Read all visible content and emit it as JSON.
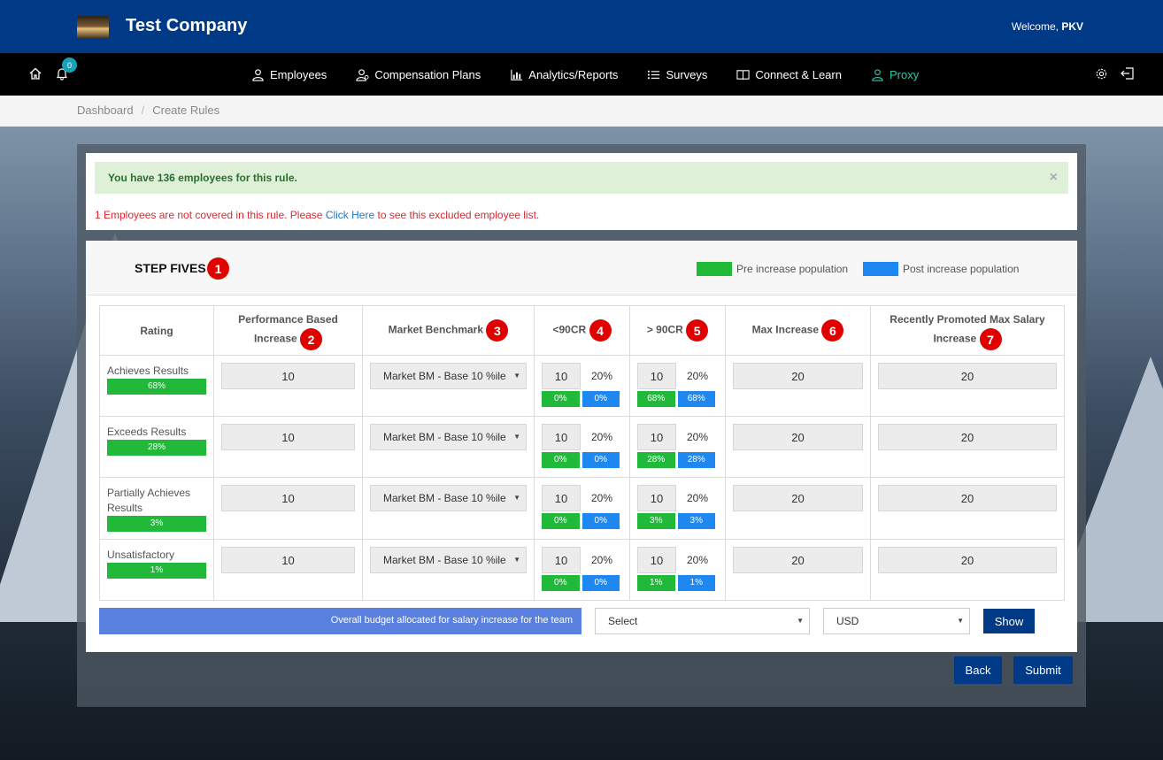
{
  "header": {
    "company": "Test Company",
    "welcome_prefix": "Welcome, ",
    "user": "PKV"
  },
  "nav": {
    "notification_count": "0",
    "items": [
      {
        "label": "Employees",
        "icon": "user-icon"
      },
      {
        "label": "Compensation Plans",
        "icon": "user-gear-icon"
      },
      {
        "label": "Analytics/Reports",
        "icon": "bar-chart-icon"
      },
      {
        "label": "Surveys",
        "icon": "list-icon"
      },
      {
        "label": "Connect & Learn",
        "icon": "book-icon"
      },
      {
        "label": "Proxy",
        "icon": "user-icon"
      }
    ]
  },
  "breadcrumb": {
    "home": "Dashboard",
    "current": "Create Rules"
  },
  "alert": {
    "success": "You have 136 employees for this rule.",
    "close": "×",
    "excluded_prefix": "1 Employees are not covered in this rule. Please ",
    "excluded_link": "Click Here",
    "excluded_suffix": " to see this excluded employee list."
  },
  "step": {
    "title": "STEP FIVES",
    "num": "1",
    "legend_pre": "Pre increase population",
    "legend_post": "Post increase population",
    "colors": {
      "pre": "#21b939",
      "post": "#1e88f0"
    }
  },
  "table": {
    "headers": [
      {
        "label": "Rating",
        "num": ""
      },
      {
        "label": "Performance Based Increase",
        "num": "2"
      },
      {
        "label": "Market Benchmark",
        "num": "3"
      },
      {
        "label": "<90CR",
        "num": "4"
      },
      {
        "label": "> 90CR",
        "num": "5"
      },
      {
        "label": "Max Increase",
        "num": "6"
      },
      {
        "label": "Recently Promoted Max Salary Increase",
        "num": "7"
      }
    ],
    "rows": [
      {
        "rating": "Achieves Results",
        "pct": "68%",
        "perf": "10",
        "benchmark": "Market BM - Base 10 %ile",
        "lt_val": "10",
        "lt_pct": "20%",
        "lt_pre": "0%",
        "lt_post": "0%",
        "gt_val": "10",
        "gt_pct": "20%",
        "gt_pre": "68%",
        "gt_post": "68%",
        "max": "20",
        "promoted": "20"
      },
      {
        "rating": "Exceeds Results",
        "pct": "28%",
        "perf": "10",
        "benchmark": "Market BM - Base 10 %ile",
        "lt_val": "10",
        "lt_pct": "20%",
        "lt_pre": "0%",
        "lt_post": "0%",
        "gt_val": "10",
        "gt_pct": "20%",
        "gt_pre": "28%",
        "gt_post": "28%",
        "max": "20",
        "promoted": "20"
      },
      {
        "rating": "Partially Achieves Results",
        "pct": "3%",
        "perf": "10",
        "benchmark": "Market BM - Base 10 %ile",
        "lt_val": "10",
        "lt_pct": "20%",
        "lt_pre": "0%",
        "lt_post": "0%",
        "gt_val": "10",
        "gt_pct": "20%",
        "gt_pre": "3%",
        "gt_post": "3%",
        "max": "20",
        "promoted": "20"
      },
      {
        "rating": "Unsatisfactory",
        "pct": "1%",
        "perf": "10",
        "benchmark": "Market BM - Base 10 %ile",
        "lt_val": "10",
        "lt_pct": "20%",
        "lt_pre": "0%",
        "lt_post": "0%",
        "gt_val": "10",
        "gt_pct": "20%",
        "gt_pre": "1%",
        "gt_post": "1%",
        "max": "20",
        "promoted": "20"
      }
    ]
  },
  "budget": {
    "label": "Overall budget allocated for salary increase for the team",
    "select_value": "Select",
    "currency_value": "USD",
    "show_label": "Show"
  },
  "actions": {
    "back": "Back",
    "submit": "Submit"
  }
}
